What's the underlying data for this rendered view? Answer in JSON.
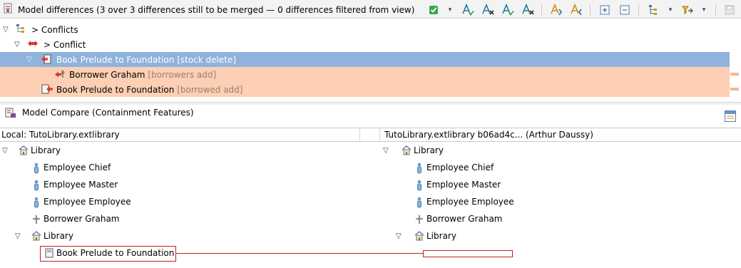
{
  "toolbar": {
    "title": "Model differences  (3 over 3 differences still to be merged — 0 differences filtered from view)",
    "icons": [
      "check-icon",
      "chevron-down-icon",
      "accept-change-icon",
      "reject-change-icon",
      "accept-all-icon",
      "reject-all-icon",
      "next-difference-icon",
      "previous-difference-icon",
      "expand-all-icon",
      "collapse-all-icon",
      "group-icon",
      "chevron-down-icon",
      "filter-icon",
      "chevron-down-icon",
      "save-icon"
    ]
  },
  "top_tree": {
    "conflicts_label": "> Conflicts",
    "conflict_label": "> Conflict",
    "selected_item": {
      "label": "Book Prelude to Foundation",
      "detail": "[stock delete]"
    },
    "child_item": {
      "label": "Borrower Graham",
      "detail": "[borrowers add]"
    },
    "sibling_item": {
      "label": "Book Prelude to Foundation",
      "detail": "[borrowed add]"
    }
  },
  "compare_pane": {
    "title": "Model Compare (Containment Features)",
    "left_header": "Local: TutoLibrary.extlibrary",
    "right_header": "TutoLibrary.extlibrary b06ad4c... (Arthur Daussy)",
    "left_tree": [
      {
        "label": "Library",
        "level": 0,
        "icon": "library-icon",
        "expanded": true
      },
      {
        "label": "Employee Chief",
        "level": 1,
        "icon": "employee-icon"
      },
      {
        "label": "Employee Master",
        "level": 1,
        "icon": "employee-icon"
      },
      {
        "label": "Employee Employee",
        "level": 1,
        "icon": "employee-icon"
      },
      {
        "label": "Borrower Graham",
        "level": 1,
        "icon": "borrower-icon"
      },
      {
        "label": "Library",
        "level": 1,
        "icon": "library-icon",
        "expanded": true
      },
      {
        "label": "Book Prelude to Foundation",
        "level": 2,
        "icon": "book-icon",
        "highlighted": true
      }
    ],
    "right_tree": [
      {
        "label": "Library",
        "level": 0,
        "icon": "library-icon",
        "expanded": true
      },
      {
        "label": "Employee Chief",
        "level": 1,
        "icon": "employee-icon"
      },
      {
        "label": "Employee Master",
        "level": 1,
        "icon": "employee-icon"
      },
      {
        "label": "Employee Employee",
        "level": 1,
        "icon": "employee-icon"
      },
      {
        "label": "Borrower Graham",
        "level": 1,
        "icon": "borrower-icon"
      },
      {
        "label": "Library",
        "level": 1,
        "icon": "library-icon",
        "expanded": true
      }
    ]
  },
  "colors": {
    "selection": "#8fb3dd",
    "conflict": "#fdcfb4",
    "diff_marker": "#c02020"
  }
}
